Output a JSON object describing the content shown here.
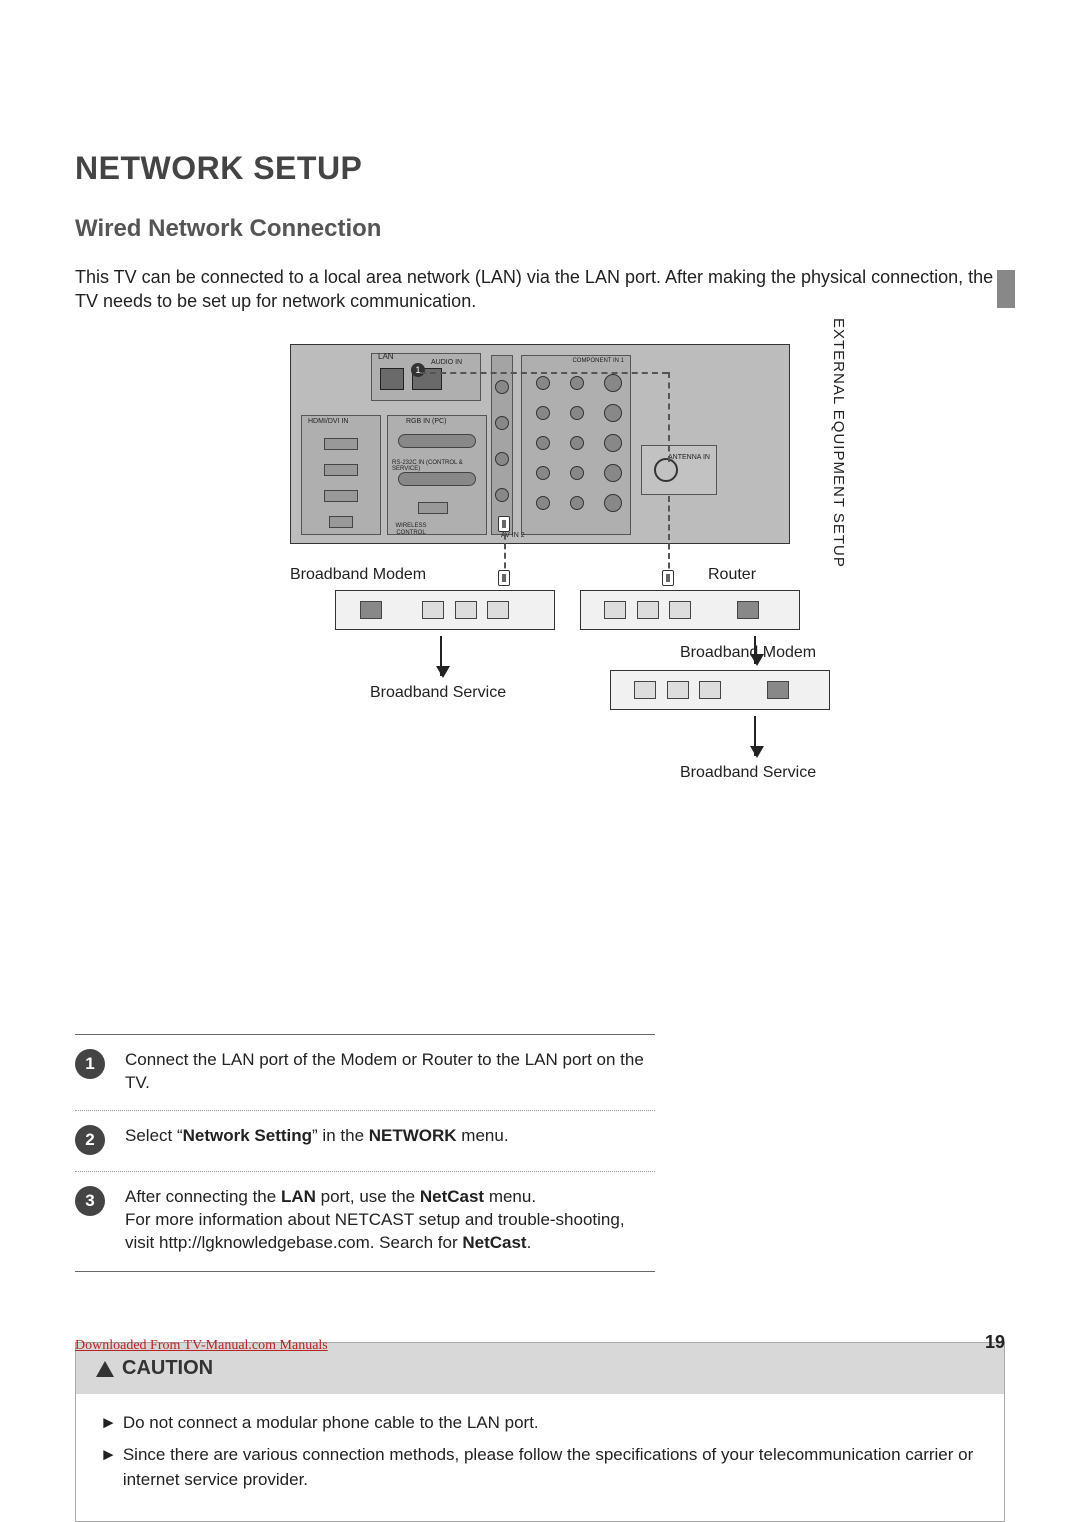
{
  "title": "NETWORK SETUP",
  "subtitle": "Wired Network Connection",
  "intro": "This TV can be connected to a local area network (LAN) via the LAN port. After making the physical connection, the TV needs to be set up for network communication.",
  "side_tab": "EXTERNAL EQUIPMENT SETUP",
  "diagram": {
    "lan_label": "LAN",
    "hdmi_label": "HDMI/DVI IN",
    "rgb_label": "RGB IN (PC)",
    "rs232_label": "RS-232C IN (CONTROL & SERVICE)",
    "wireless_label": "WIRELESS CONTROL",
    "component_label": "COMPONENT IN 1",
    "antenna_label": "ANTENNA IN",
    "audio_in": "AUDIO IN",
    "av_in2": "AV IN 2",
    "badge_one": "1",
    "broadband_modem": "Broadband Modem",
    "router": "Router",
    "broadband_service": "Broadband Service"
  },
  "steps": [
    {
      "num": "1",
      "text": "Connect the LAN port of the Modem or Router to the LAN port on the TV."
    },
    {
      "num": "2",
      "prefix": "Select “",
      "bold1": "Network Setting",
      "mid": "” in the ",
      "bold2": "NETWORK",
      "suffix": " menu."
    },
    {
      "num": "3",
      "line1a": "After connecting the ",
      "line1b": "LAN",
      "line1c": " port, use the ",
      "line1d": "NetCast",
      "line1e": " menu.",
      "line2": "For more information about NETCAST setup and trouble-shooting, visit http://lgknowledgebase.com. Search for ",
      "line2bold": "NetCast",
      "line2end": "."
    }
  ],
  "caution": {
    "heading": "CAUTION",
    "items": [
      "Do not connect a modular phone cable to the LAN port.",
      "Since there are various connection methods, please follow the specifications of your telecommunication carrier or internet service provider."
    ]
  },
  "page_number": "19",
  "footer_link": "Downloaded From TV-Manual.com Manuals"
}
